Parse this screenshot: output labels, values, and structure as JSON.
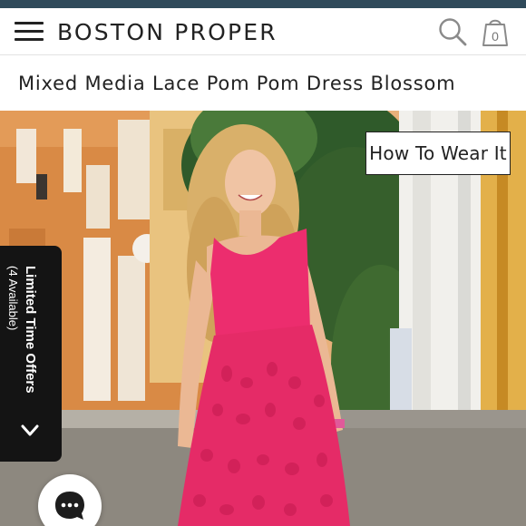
{
  "app": {
    "brand": "BOSTON PROPER",
    "accent_color": "#2f4a5a"
  },
  "header": {
    "menu_icon": "hamburger-menu-icon",
    "search_icon": "search-icon",
    "cart_icon": "shopping-bag-icon",
    "cart_count": "0"
  },
  "product": {
    "title": "Mixed Media Lace Pom Pom Dress Blossom",
    "dress_color": "#ec2d6e"
  },
  "hero": {
    "how_to_wear_label": "How To Wear It"
  },
  "offers": {
    "label": "Limited Time Offers",
    "sub_label": "(4 Available)",
    "chevron_icon": "chevron-down-icon"
  },
  "chat": {
    "icon": "chat-bubble-icon"
  }
}
